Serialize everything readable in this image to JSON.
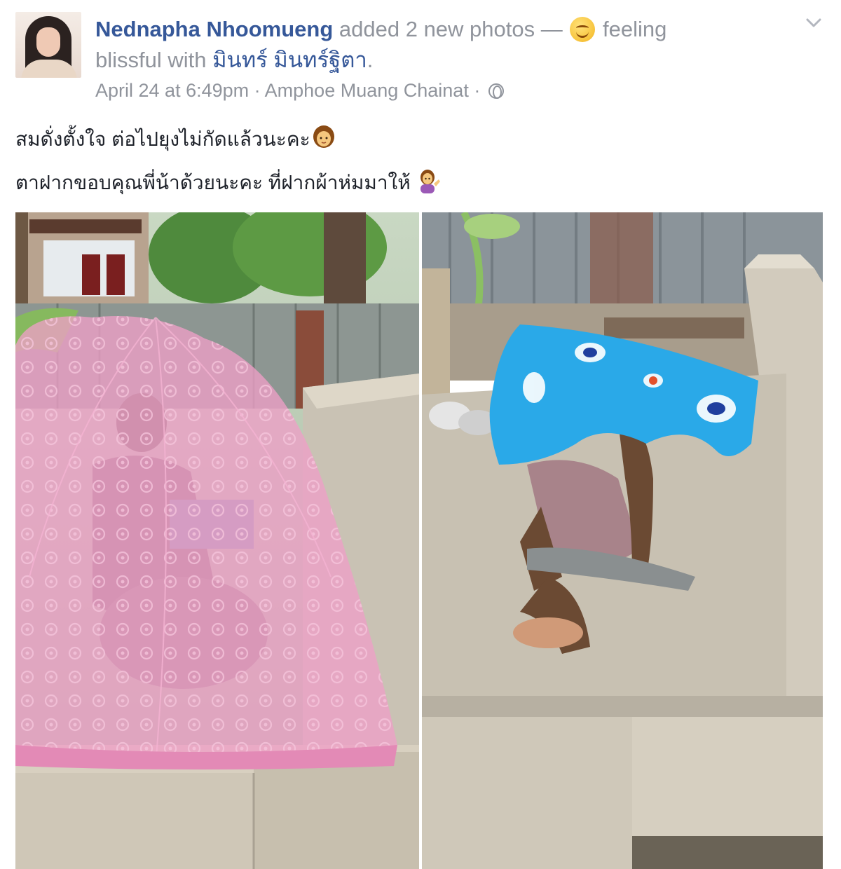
{
  "post": {
    "author": "Nednapha Nhoomueng",
    "action_text": " added 2 new photos — ",
    "feeling_text": " feeling",
    "feeling_word": "blissful with ",
    "tagged_person": "มินทร์ มินทร์ฐิตา",
    "tag_end": ".",
    "date": "April 24 at 6:49pm",
    "separator1": " · ",
    "location": "Amphoe Muang Chainat",
    "separator2": " · ",
    "message_line1": "สมดั่งตั้งใจ ต่อไปยุงไม่กัดแล้วนะคะ",
    "message_line2": "ตาฝากขอบคุณพี่น้าด้วยนะคะ ที่ฝากผ้าห่มมาให้ ",
    "icons": {
      "menu": "chevron-down-icon",
      "feeling": "smiling-face-icon",
      "privacy": "globe-icon",
      "emoji1": "woman-emoji-icon",
      "emoji2": "woman-tipping-hand-emoji-icon"
    },
    "colors": {
      "link": "#365899",
      "meta": "#90949c",
      "text": "#1d2129",
      "net_pink": "#ee9fc6",
      "blanket_blue": "#2aa9e8"
    }
  }
}
